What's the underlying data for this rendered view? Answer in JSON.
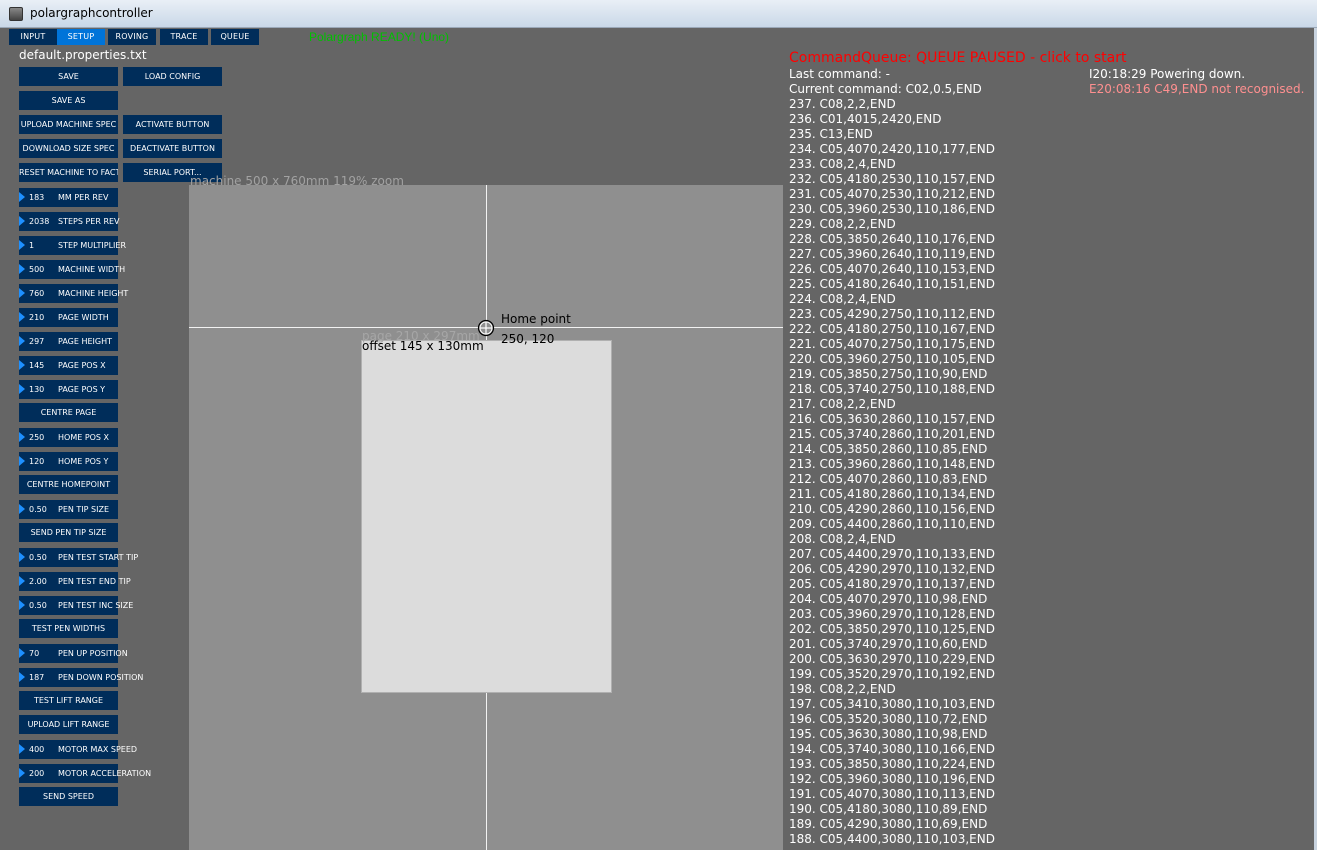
{
  "window": {
    "title": "polargraphcontroller"
  },
  "tabs": [
    "INPUT",
    "SETUP",
    "ROVING",
    "TRACE",
    "QUEUE"
  ],
  "status": {
    "ready_text": "Polargraph READY! (Uno)"
  },
  "properties_file": "default.properties.txt",
  "buttons": {
    "save": "SAVE",
    "load_config": "LOAD CONFIG",
    "save_as": "SAVE AS",
    "upload_machine_spec": "UPLOAD MACHINE SPEC",
    "activate_button": "ACTIVATE BUTTON",
    "download_size_spec": "DOWNLOAD SIZE SPEC",
    "deactivate_button": "DEACTIVATE BUTTON",
    "reset_machine": "RESET MACHINE TO FACTORY",
    "serial_port": "SERIAL PORT...",
    "centre_page": "CENTRE PAGE",
    "centre_homepoint": "CENTRE HOMEPOINT",
    "send_pen_tip_size": "SEND PEN TIP SIZE",
    "test_pen_widths": "TEST PEN WIDTHS",
    "test_lift_range": "TEST LIFT RANGE",
    "upload_lift_range": "UPLOAD LIFT RANGE",
    "send_speed": "SEND SPEED"
  },
  "controls": {
    "mm_per_rev": {
      "value": "183",
      "label": "MM PER REV"
    },
    "steps_per_rev": {
      "value": "2038",
      "label": "STEPS PER REV"
    },
    "step_multiplier": {
      "value": "1",
      "label": "STEP MULTIPLIER"
    },
    "machine_width": {
      "value": "500",
      "label": "MACHINE WIDTH"
    },
    "machine_height": {
      "value": "760",
      "label": "MACHINE HEIGHT"
    },
    "page_width": {
      "value": "210",
      "label": "PAGE WIDTH"
    },
    "page_height": {
      "value": "297",
      "label": "PAGE HEIGHT"
    },
    "page_pos_x": {
      "value": "145",
      "label": "PAGE POS X"
    },
    "page_pos_y": {
      "value": "130",
      "label": "PAGE POS Y"
    },
    "home_pos_x": {
      "value": "250",
      "label": "HOME POS X"
    },
    "home_pos_y": {
      "value": "120",
      "label": "HOME POS Y"
    },
    "pen_tip_size": {
      "value": "0.50",
      "label": "PEN TIP SIZE"
    },
    "pen_test_start_tip": {
      "value": "0.50",
      "label": "PEN TEST START TIP"
    },
    "pen_test_end_tip": {
      "value": "2.00",
      "label": "PEN TEST END TIP"
    },
    "pen_test_inc_size": {
      "value": "0.50",
      "label": "PEN TEST INC SIZE"
    },
    "pen_up_position": {
      "value": "70",
      "label": "PEN UP POSITION"
    },
    "pen_down_position": {
      "value": "187",
      "label": "PEN DOWN POSITION"
    },
    "motor_max_speed": {
      "value": "400",
      "label": "MOTOR MAX SPEED"
    },
    "motor_acceleration": {
      "value": "200",
      "label": "MOTOR ACCELERATION"
    }
  },
  "machine": {
    "label": "machine 500 x 760mm 119% zoom",
    "page_size_label": "page 210 x 297mm",
    "page_offset_label": "offset 145 x 130mm",
    "home_label": "Home point",
    "home_coords": "250, 120"
  },
  "queue": {
    "header": "CommandQueue: QUEUE PAUSED - click to start",
    "last_command": "Last command: -",
    "current_command": "Current command: C02,0.5,END",
    "console_info": "I20:18:29 Powering down.",
    "console_error": "E20:08:16 C49,END not recognised.",
    "items": [
      "237. C08,2,2,END",
      "236. C01,4015,2420,END",
      "235. C13,END",
      "234. C05,4070,2420,110,177,END",
      "233. C08,2,4,END",
      "232. C05,4180,2530,110,157,END",
      "231. C05,4070,2530,110,212,END",
      "230. C05,3960,2530,110,186,END",
      "229. C08,2,2,END",
      "228. C05,3850,2640,110,176,END",
      "227. C05,3960,2640,110,119,END",
      "226. C05,4070,2640,110,153,END",
      "225. C05,4180,2640,110,151,END",
      "224. C08,2,4,END",
      "223. C05,4290,2750,110,112,END",
      "222. C05,4180,2750,110,167,END",
      "221. C05,4070,2750,110,175,END",
      "220. C05,3960,2750,110,105,END",
      "219. C05,3850,2750,110,90,END",
      "218. C05,3740,2750,110,188,END",
      "217. C08,2,2,END",
      "216. C05,3630,2860,110,157,END",
      "215. C05,3740,2860,110,201,END",
      "214. C05,3850,2860,110,85,END",
      "213. C05,3960,2860,110,148,END",
      "212. C05,4070,2860,110,83,END",
      "211. C05,4180,2860,110,134,END",
      "210. C05,4290,2860,110,156,END",
      "209. C05,4400,2860,110,110,END",
      "208. C08,2,4,END",
      "207. C05,4400,2970,110,133,END",
      "206. C05,4290,2970,110,132,END",
      "205. C05,4180,2970,110,137,END",
      "204. C05,4070,2970,110,98,END",
      "203. C05,3960,2970,110,128,END",
      "202. C05,3850,2970,110,125,END",
      "201. C05,3740,2970,110,60,END",
      "200. C05,3630,2970,110,229,END",
      "199. C05,3520,2970,110,192,END",
      "198. C08,2,2,END",
      "197. C05,3410,3080,110,103,END",
      "196. C05,3520,3080,110,72,END",
      "195. C05,3630,3080,110,98,END",
      "194. C05,3740,3080,110,166,END",
      "193. C05,3850,3080,110,224,END",
      "192. C05,3960,3080,110,196,END",
      "191. C05,4070,3080,110,113,END",
      "190. C05,4180,3080,110,89,END",
      "189. C05,4290,3080,110,69,END",
      "188. C05,4400,3080,110,103,END"
    ]
  }
}
